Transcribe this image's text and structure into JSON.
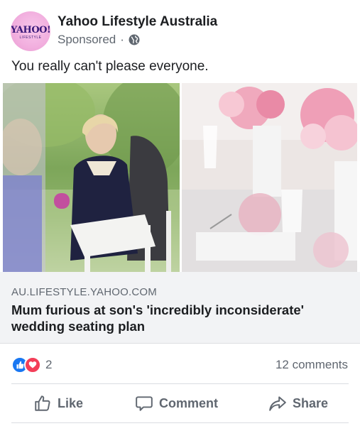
{
  "post": {
    "page_name": "Yahoo Lifestyle Australia",
    "sponsored_label": "Sponsored",
    "separator": "·",
    "avatar": {
      "logo_text": "YAHOO!",
      "logo_sub": "LIFESTYLE"
    },
    "caption": "You really can't please everyone."
  },
  "link": {
    "domain": "AU.LIFESTYLE.YAHOO.COM",
    "headline": "Mum furious at son's 'incredibly inconsiderate' wedding seating plan"
  },
  "engagement": {
    "reaction_count": "2",
    "comments": "12 comments",
    "reaction_icons": [
      "like-reaction",
      "love-reaction"
    ]
  },
  "actions": {
    "like": "Like",
    "comment": "Comment",
    "share": "Share"
  },
  "colors": {
    "like_blue": "#1877f2",
    "love_red": "#f33e58",
    "secondary_text": "#606770",
    "link_bg": "#f2f3f5"
  }
}
